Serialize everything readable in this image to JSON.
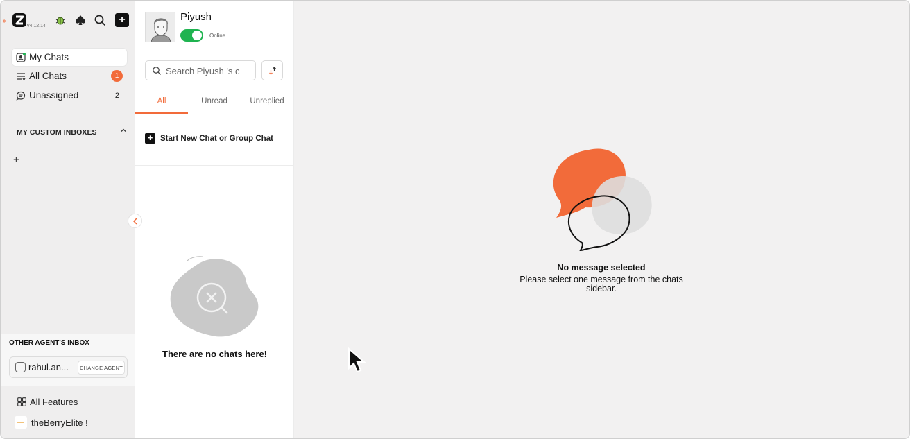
{
  "app": {
    "version": "v4.12.14",
    "logo_letter": "Z"
  },
  "topbar": {
    "icons": [
      "bug-icon",
      "spade-icon",
      "search-icon",
      "add-icon"
    ]
  },
  "sidebar": {
    "items": [
      {
        "label": "My Chats",
        "icon": "chat-user-icon",
        "active": true
      },
      {
        "label": "All Chats",
        "icon": "list-icon",
        "badge": "1"
      },
      {
        "label": "Unassigned",
        "icon": "chat-bubble-icon",
        "count": "2"
      }
    ],
    "custom_inboxes_heading": "MY CUSTOM INBOXES",
    "add_inbox_label": "+",
    "other_agent": {
      "title": "OTHER AGENT'S INBOX",
      "agent_name": "rahul.an...",
      "change_button": "CHANGE AGENT"
    },
    "bottom": {
      "all_features": "All Features",
      "account": "theBerryElite !"
    }
  },
  "profile": {
    "name": "Piyush",
    "status": "Online",
    "online": true
  },
  "search": {
    "placeholder": "Search Piyush 's c"
  },
  "tabs": [
    {
      "label": "All",
      "active": true
    },
    {
      "label": "Unread"
    },
    {
      "label": "Unreplied"
    }
  ],
  "chatlist": {
    "new_chat_label": "Start New Chat or Group Chat",
    "empty_text": "There are no chats here!"
  },
  "main": {
    "title": "No message selected",
    "subtitle": "Please select one message from the chats sidebar."
  },
  "colors": {
    "accent": "#f26b3a",
    "online_green": "#1fb350",
    "background": "#f2f1f1"
  }
}
